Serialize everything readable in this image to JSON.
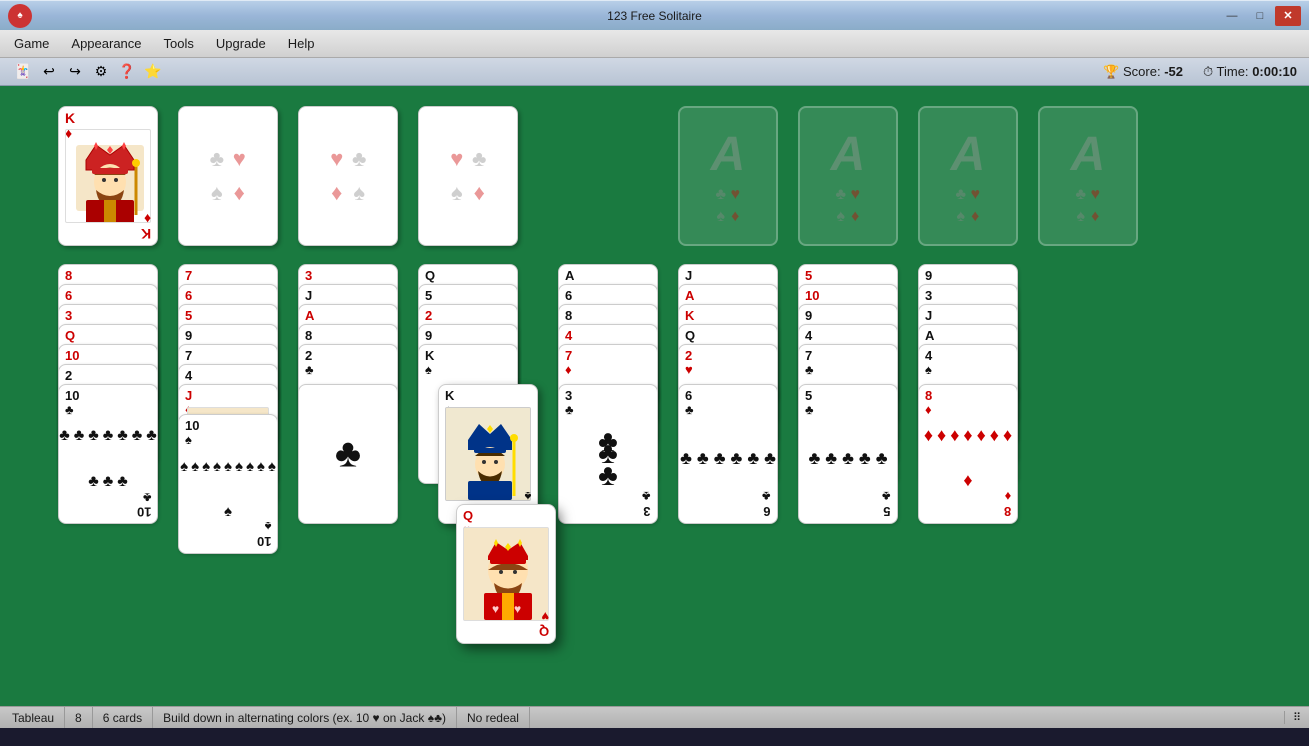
{
  "titlebar": {
    "title": "123 Free Solitaire",
    "min_btn": "—",
    "max_btn": "□",
    "close_btn": "✕"
  },
  "menubar": {
    "items": [
      {
        "label": "Game",
        "id": "game"
      },
      {
        "label": "Appearance",
        "id": "appearance"
      },
      {
        "label": "Tools",
        "id": "tools"
      },
      {
        "label": "Upgrade",
        "id": "upgrade"
      },
      {
        "label": "Help",
        "id": "help"
      }
    ]
  },
  "toolbar": {
    "score_label": "Score:",
    "score_value": "-52",
    "time_label": "Time:",
    "time_value": "0:00:10"
  },
  "statusbar": {
    "game_type": "Tableau",
    "col_count": "8",
    "card_count": "6 cards",
    "rule": "Build down in alternating colors (ex. 10 ♥ on Jack ♠♣)",
    "redeal": "No redeal"
  }
}
